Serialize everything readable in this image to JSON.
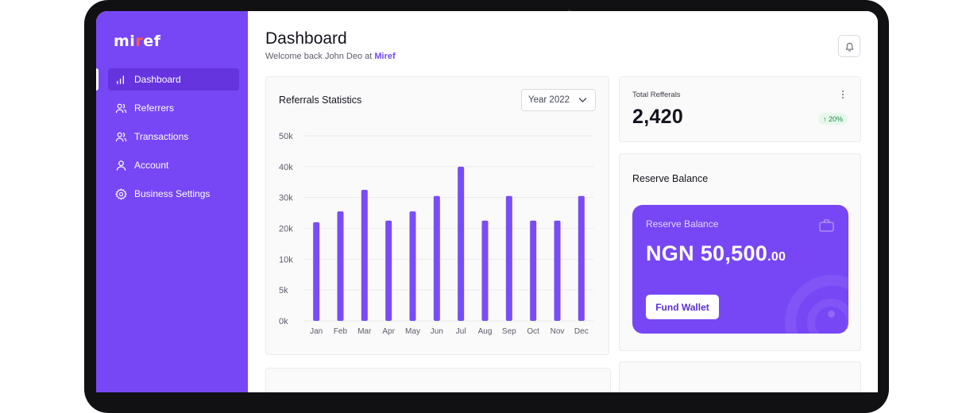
{
  "app": {
    "logo_prefix": "mi",
    "logo_dot": "r",
    "logo_suffix": "ef"
  },
  "sidebar": {
    "items": [
      {
        "label": "Dashboard",
        "icon": "bar-chart-icon",
        "active": true
      },
      {
        "label": "Referrers",
        "icon": "users-icon",
        "active": false
      },
      {
        "label": "Transactions",
        "icon": "users-icon",
        "active": false
      },
      {
        "label": "Account",
        "icon": "user-icon",
        "active": false
      },
      {
        "label": "Business Settings",
        "icon": "gear-icon",
        "active": false
      }
    ]
  },
  "header": {
    "title": "Dashboard",
    "subtitle_prefix": "Welcome back John Deo at ",
    "subtitle_brand": "Miref",
    "notification_icon": "bell-icon"
  },
  "referrals_card": {
    "title": "Referrals Statistics",
    "year_select": "Year 2022"
  },
  "chart_data": {
    "type": "bar",
    "categories": [
      "Jan",
      "Feb",
      "Mar",
      "Apr",
      "May",
      "Jun",
      "Jul",
      "Aug",
      "Sep",
      "Oct",
      "Nov",
      "Dec"
    ],
    "values": [
      22000,
      25500,
      32500,
      22500,
      25500,
      30500,
      40000,
      22500,
      30500,
      22500,
      22500,
      30500
    ],
    "yticks": [
      "0k",
      "5k",
      "10k",
      "20k",
      "30k",
      "40k",
      "50k"
    ],
    "ylim": [
      0,
      50000
    ],
    "grid": true,
    "title": "Referrals Statistics",
    "xlabel": "",
    "ylabel": "",
    "bar_color": "#7a4cf5"
  },
  "total_referrals": {
    "label": "Total Refferals",
    "value": "2,420",
    "change": "↑ 20%"
  },
  "reserve": {
    "title": "Reserve Balance",
    "card_label": "Reserve Balance",
    "amount_main": "NGN 50,500",
    "amount_decimal": ".00",
    "button_label": "Fund Wallet"
  },
  "colors": {
    "accent": "#7747f5",
    "positive": "#1c8a45"
  }
}
